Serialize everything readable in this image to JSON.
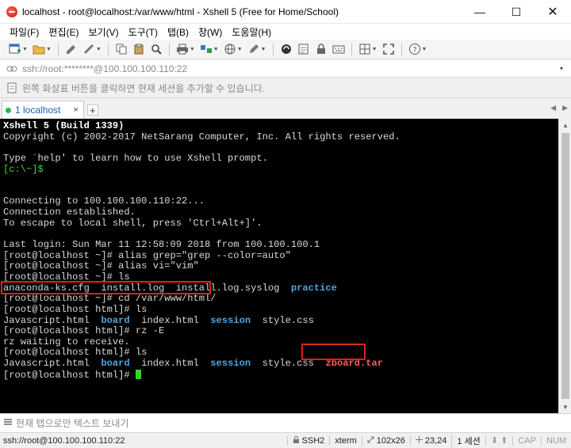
{
  "window": {
    "title": "localhost - root@localhost:/var/www/html - Xshell 5 (Free for Home/School)",
    "min_glyph": "—",
    "max_glyph": "☐",
    "close_glyph": "✕"
  },
  "menu": [
    "파일(F)",
    "편집(E)",
    "보기(V)",
    "도구(T)",
    "탭(B)",
    "창(W)",
    "도움말(H)"
  ],
  "address": {
    "text": "ssh://root:********@100.100.100.110:22",
    "dropdown_glyph": "▾"
  },
  "hint": {
    "text": "왼쪽 화살표 버튼을 클릭하면 현재 세션을 추가할 수 있습니다."
  },
  "tabs": [
    {
      "label": "1 localhost",
      "close_glyph": "×"
    }
  ],
  "tab_add_glyph": "+",
  "tab_nav": {
    "prev": "◀",
    "next": "▶"
  },
  "terminal": {
    "header1": "Xshell 5 (Build 1339)",
    "header2": "Copyright (c) 2002-2017 NetSarang Computer, Inc. All rights reserved.",
    "help": "Type `help' to learn how to use Xshell prompt.",
    "local_prompt": "[c:\\~]$",
    "connecting": "Connecting to 100.100.100.110:22...",
    "established": "Connection established.",
    "escape": "To escape to local shell, press 'Ctrl+Alt+]'.",
    "last_login": "Last login: Sun Mar 11 12:58:09 2018 from 100.100.100.1",
    "cmd1": "[root@localhost ~]# alias grep=\"grep --color=auto\"",
    "cmd2": "[root@localhost ~]# alias vi=\"vim\"",
    "cmd3": "[root@localhost ~]# ls",
    "ls1": {
      "files": "anaconda-ks.cfg  install.log  install.log.syslog  ",
      "dir": "practice"
    },
    "cmd_cd": "[root@localhost ~]# cd /var/www/html/",
    "cmd4": "[root@localhost html]# ls",
    "ls2": {
      "f1": "Javascript.html  ",
      "d1": "board",
      "f2": "  index.html  ",
      "d2": "session",
      "f3": "  style.css"
    },
    "cmd_rz": "[root@localhost html]# rz -E",
    "rz_wait": "rz waiting to receive.",
    "cmd5": "[root@localhost html]# ls",
    "ls3": {
      "f1": "Javascript.html  ",
      "d1": "board",
      "f2": "  index.html  ",
      "d2": "session",
      "f3": "  style.css  ",
      "new_file": "zboard.tar"
    },
    "final_prompt": "[root@localhost html]# ",
    "highlight_color": "#e0201c"
  },
  "scroll": {
    "up": "▲",
    "down": "▼"
  },
  "sendbar": {
    "text": "현재 탭으로만 텍스트 보내기"
  },
  "status": {
    "connection": "ssh://root@100.100.100.110:22",
    "protocol": "SSH2",
    "terminal_type": "xterm",
    "size": "102x26",
    "cursor": "23,24",
    "sessions": "1 세션",
    "down_arrow": "⬇",
    "up_arrow": "⬆",
    "caps": "CAP",
    "num": "NUM"
  }
}
